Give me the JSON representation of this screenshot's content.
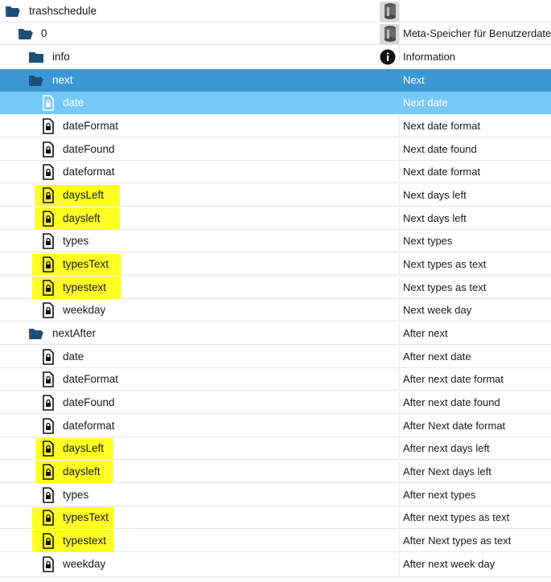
{
  "tree": {
    "root": {
      "label": "trashschedule",
      "icon": "folder-open-icon",
      "action_icon": "database-icon"
    },
    "instance": {
      "label": "0",
      "icon": "folder-open-icon",
      "action_icon": "database-icon",
      "description": "Meta-Speicher für Benutzerdateien"
    },
    "info": {
      "label": "info",
      "icon": "folder-closed-icon",
      "action_icon": "info-icon",
      "description": "Information"
    },
    "next": {
      "label": "next",
      "description": "Next",
      "states": [
        {
          "label": "date",
          "description": "Next date"
        },
        {
          "label": "dateFormat",
          "description": "Next date format"
        },
        {
          "label": "dateFound",
          "description": "Next date found"
        },
        {
          "label": "dateformat",
          "description": "Next date format"
        },
        {
          "label": "daysLeft",
          "description": "Next days left"
        },
        {
          "label": "daysleft",
          "description": "Next days left"
        },
        {
          "label": "types",
          "description": "Next types"
        },
        {
          "label": "typesText",
          "description": "Next types as text"
        },
        {
          "label": "typestext",
          "description": "Next types as text"
        },
        {
          "label": "weekday",
          "description": "Next week day"
        }
      ]
    },
    "nextAfter": {
      "label": "nextAfter",
      "description": "After next",
      "states": [
        {
          "label": "date",
          "description": "After next date"
        },
        {
          "label": "dateFormat",
          "description": "After next date format"
        },
        {
          "label": "dateFound",
          "description": "After next date found"
        },
        {
          "label": "dateformat",
          "description": "After Next date format"
        },
        {
          "label": "daysLeft",
          "description": "After next days left"
        },
        {
          "label": "daysleft",
          "description": "After Next days left"
        },
        {
          "label": "types",
          "description": "After next types"
        },
        {
          "label": "typesText",
          "description": "After next types as text"
        },
        {
          "label": "typestext",
          "description": "After Next types as text"
        },
        {
          "label": "weekday",
          "description": "After next week day"
        }
      ]
    }
  },
  "colors": {
    "selected_row": "#3c98d3",
    "selected_child_row": "#76c9f7",
    "highlight": "#ffff24",
    "folder": "#1f4e79"
  }
}
